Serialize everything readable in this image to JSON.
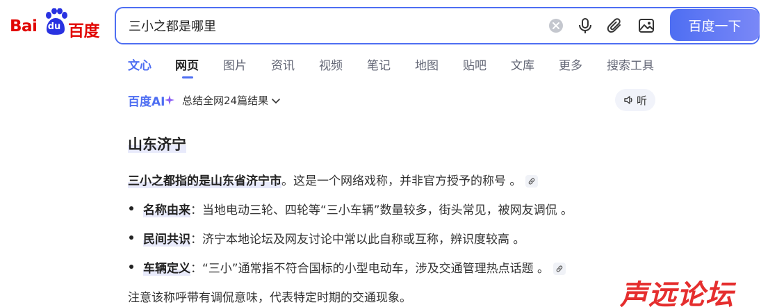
{
  "logo": {
    "part1": "Bai",
    "part2": "du",
    "part3": "百度"
  },
  "search": {
    "query": "三小之都是哪里",
    "button_label": "百度一下"
  },
  "tabs": [
    {
      "label": "文心"
    },
    {
      "label": "网页"
    },
    {
      "label": "图片"
    },
    {
      "label": "资讯"
    },
    {
      "label": "视频"
    },
    {
      "label": "笔记"
    },
    {
      "label": "地图"
    },
    {
      "label": "贴吧"
    },
    {
      "label": "文库"
    },
    {
      "label": "更多"
    },
    {
      "label": "搜索工具"
    }
  ],
  "ai": {
    "logo_text": "百度AI",
    "summary": "总结全网24篇结果",
    "listen_label": "听"
  },
  "answer": {
    "heading": "山东济宁",
    "intro_bold": "三小之都指的是山东省济宁市",
    "intro_rest": "。这是一个网络戏称，并非官方授予的称号 。",
    "items": [
      {
        "term": "名称由来",
        "desc": "：当地电动三轮、四轮等“三小车辆”数量较多，街头常见，被网友调侃 。"
      },
      {
        "term": "民间共识",
        "desc": "：济宁本地论坛及网友讨论中常以此自称或互称，辨识度较高 。"
      },
      {
        "term": "车辆定义",
        "desc": "：“三小”通常指不符合国标的小型电动车，涉及交通管理热点话题 。"
      }
    ],
    "note": "注意该称呼带有调侃意味，代表特定时期的交通现象。"
  },
  "watermark": "声远论坛",
  "colors": {
    "brand_red": "#e10602",
    "brand_blue": "#4e6ef2"
  },
  "icons": [
    "clear-icon",
    "microphone-icon",
    "attachment-icon",
    "image-search-icon",
    "chevron-down-icon",
    "speaker-icon",
    "link-icon",
    "sparkle-icon"
  ]
}
